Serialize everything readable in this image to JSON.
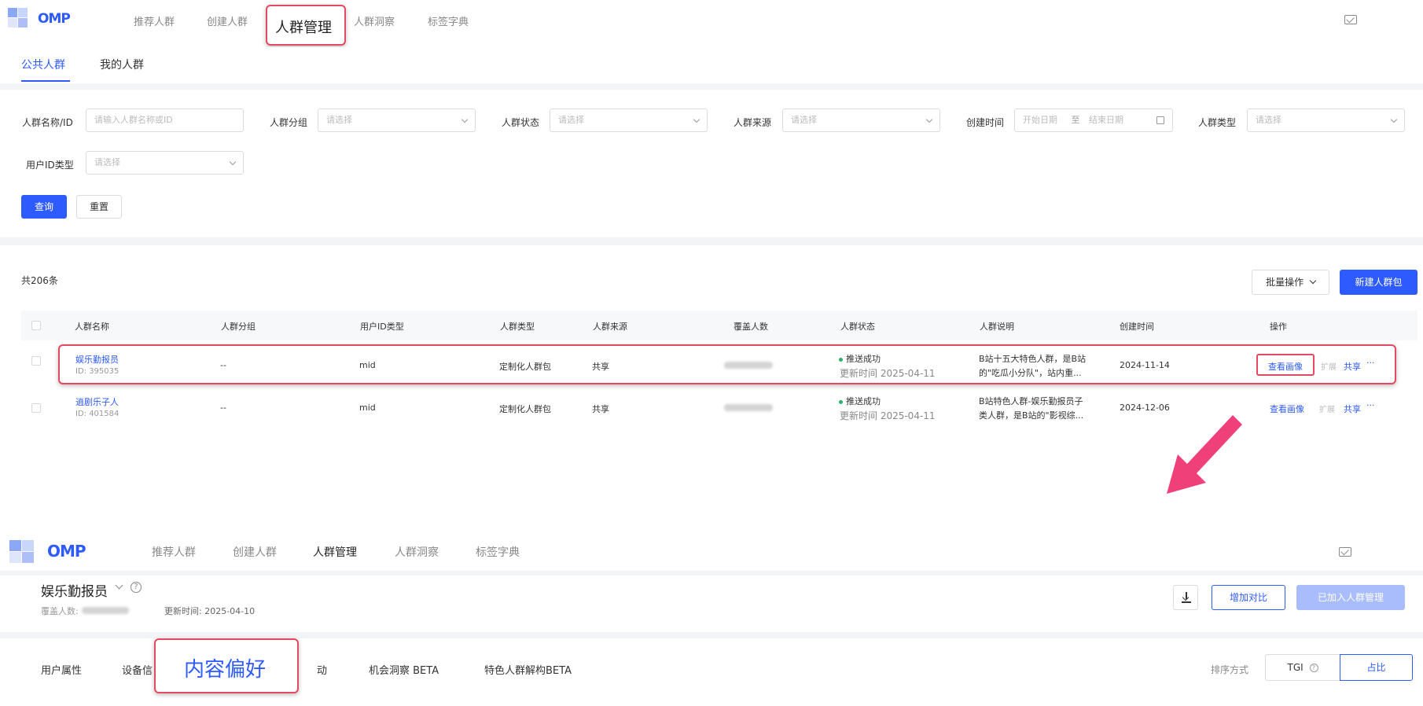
{
  "top": {
    "logo_text": "OMP",
    "nav": [
      "推荐人群",
      "创建人群",
      "人群管理",
      "人群洞察",
      "标签字典"
    ],
    "subtabs": [
      "公共人群",
      "我的人群"
    ]
  },
  "filters": {
    "name_label": "人群名称/ID",
    "name_placeholder": "请输入人群名称或ID",
    "group_label": "人群分组",
    "status_label": "人群状态",
    "source_label": "人群来源",
    "created_label": "创建时间",
    "start_placeholder": "开始日期",
    "to": "至",
    "end_placeholder": "结束日期",
    "type_label": "人群类型",
    "uid_label": "用户ID类型",
    "select_placeholder": "请选择",
    "query": "查询",
    "reset": "重置"
  },
  "list": {
    "total": "共206条",
    "batch": "批量操作",
    "create": "新建人群包",
    "columns": [
      "人群名称",
      "人群分组",
      "用户ID类型",
      "人群类型",
      "人群来源",
      "覆盖人数",
      "人群状态",
      "人群说明",
      "创建时间",
      "操作"
    ],
    "rows": [
      {
        "name": "娱乐勤报员",
        "id": "ID: 395035",
        "group": "--",
        "uid": "mid",
        "type": "定制化人群包",
        "source": "共享",
        "status": "推送成功",
        "updated": "更新时间 2025-04-11",
        "desc": "B站十五大特色人群，是B站",
        "desc2": "的\"吃瓜小分队\"，站内重...",
        "created": "2024-11-14",
        "op_view": "查看画像",
        "op_expand": "扩展",
        "op_share": "共享",
        "op_more": "···"
      },
      {
        "name": "逍剧乐子人",
        "id": "ID: 401584",
        "group": "--",
        "uid": "mid",
        "type": "定制化人群包",
        "source": "共享",
        "status": "推送成功",
        "updated": "更新时间 2025-04-11",
        "desc": "B站特色人群-娱乐勤报员子",
        "desc2": "类人群，是B站的\"影视综...",
        "created": "2024-12-06",
        "op_view": "查看画像",
        "op_expand": "扩展",
        "op_share": "共享",
        "op_more": "···"
      }
    ]
  },
  "detail": {
    "title": "娱乐勤报员",
    "coverage_label": "覆盖人数:",
    "updated": "更新时间: 2025-04-10",
    "compare": "增加对比",
    "added": "已加入人群管理",
    "tabs": [
      "用户属性",
      "设备信",
      "内容偏好",
      "动",
      "机会洞察 BETA",
      "特色人群解构BETA"
    ],
    "sort_label": "排序方式",
    "sort_tgi": "TGI",
    "sort_ratio": "占比"
  },
  "colors": {
    "primary": "#2e5bff",
    "highlight": "#e5485f",
    "arrow": "#f0407a",
    "success": "#27b36a"
  }
}
